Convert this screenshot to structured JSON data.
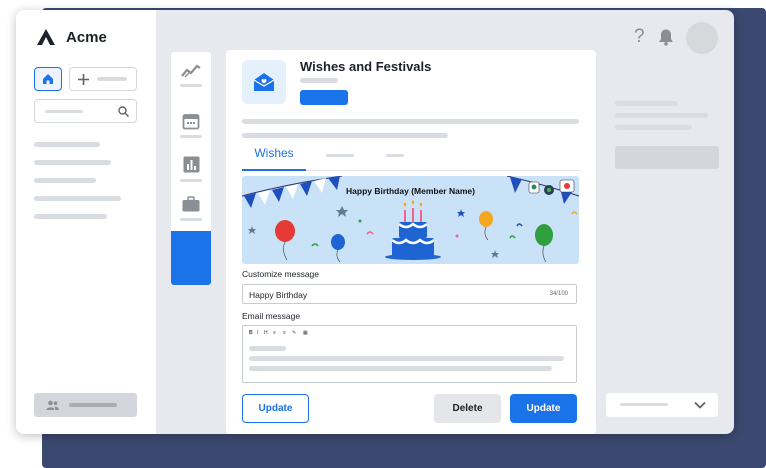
{
  "app": {
    "name": "Acme"
  },
  "card": {
    "title": "Wishes and Festivals",
    "tabs": [
      "Wishes"
    ],
    "banner_title": "Happy Birthday (Member Name)",
    "customize_label": "Customize message",
    "customize_value": "Happy Birthday",
    "char_count": "34/100",
    "email_label": "Email message",
    "toolbar": [
      "B",
      "I",
      "H",
      "≡",
      "≡",
      "✎",
      "▦"
    ],
    "update_outline_label": "Update",
    "delete_label": "Delete",
    "update_primary_label": "Update"
  },
  "topbar": {
    "help_icon": "?"
  },
  "colors": {
    "accent": "#1a73e8",
    "back_panel": "#3b4970",
    "banner_bg": "#c9e2f7"
  },
  "icons": [
    "logo-icon",
    "home-icon",
    "plus-icon",
    "search-icon",
    "chart-icon",
    "calendar-icon",
    "bar-chart-icon",
    "briefcase-icon",
    "envelope-icon",
    "help-icon",
    "bell-icon",
    "users-icon",
    "chevron-down-icon"
  ]
}
